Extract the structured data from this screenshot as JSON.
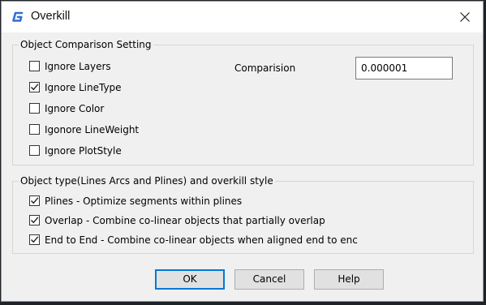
{
  "window": {
    "title": "Overkill",
    "app_icon": "gstarcad-g-icon",
    "close_icon": "close-icon"
  },
  "comparison_group": {
    "legend": "Object Comparison Setting",
    "options": [
      {
        "label": "Ignore Layers",
        "checked": false
      },
      {
        "label": "Ignore LineType",
        "checked": true
      },
      {
        "label": "Ignore Color",
        "checked": false
      },
      {
        "label": "Igonore LineWeight",
        "checked": false
      },
      {
        "label": "Ignore PlotStyle",
        "checked": false
      }
    ],
    "comparison_label": "Comparision",
    "comparison_value": "0.000001"
  },
  "style_group": {
    "legend": "Object type(Lines Arcs and Plines) and overkill style",
    "options": [
      {
        "label": "Plines - Optimize segments within plines",
        "checked": true
      },
      {
        "label": "Overlap - Combine co-linear objects that partially overlap",
        "checked": true
      },
      {
        "label": "End to End - Combine co-linear objects when aligned end to enc",
        "checked": true
      }
    ]
  },
  "buttons": {
    "ok": "OK",
    "cancel": "Cancel",
    "help": "Help"
  },
  "colors": {
    "accent": "#0078d7",
    "app_icon": "#2f6fd6",
    "dialog_bg": "#f0f0f0"
  }
}
